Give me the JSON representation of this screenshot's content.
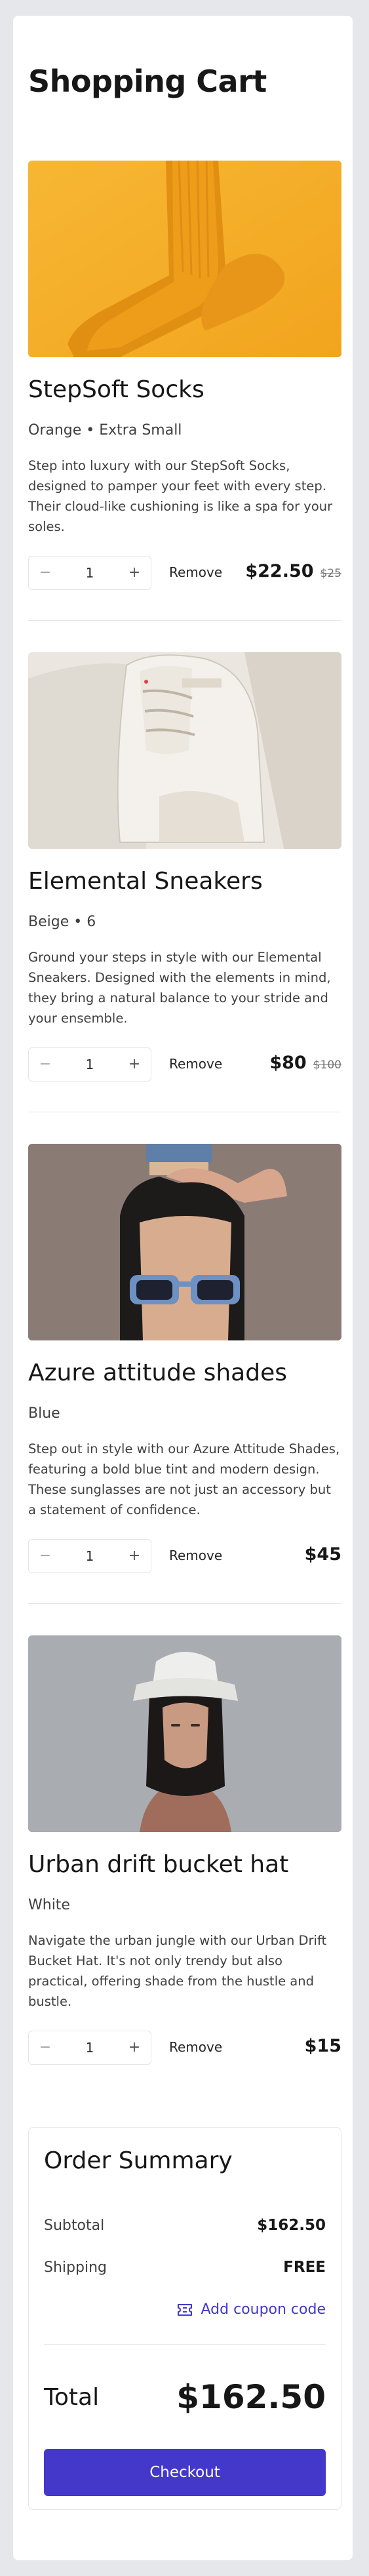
{
  "page": {
    "title": "Shopping Cart"
  },
  "items": [
    {
      "name": "StepSoft Socks",
      "variant": "Orange • Extra Small",
      "description": "Step into luxury with our StepSoft Socks, designed to pamper your feet with every step. Their cloud-like cushioning is like a spa for your soles.",
      "quantity": "1",
      "remove_label": "Remove",
      "price": "$22.50",
      "original_price": "$25",
      "image": "orange-socks"
    },
    {
      "name": "Elemental Sneakers",
      "variant": "Beige • 6",
      "description": "Ground your steps in style with our Elemental Sneakers. Designed with the elements in mind, they bring a natural balance to your stride and your ensemble.",
      "quantity": "1",
      "remove_label": "Remove",
      "price": "$80",
      "original_price": "$100",
      "image": "white-sneaker"
    },
    {
      "name": "Azure attitude shades",
      "variant": "Blue",
      "description": "Step out in style with our Azure Attitude Shades, featuring a bold blue tint and modern design. These sunglasses are not just an accessory but a statement of confidence.",
      "quantity": "1",
      "remove_label": "Remove",
      "price": "$45",
      "original_price": "",
      "image": "blue-sunglasses-model"
    },
    {
      "name": "Urban drift bucket hat",
      "variant": "White",
      "description": "Navigate the urban jungle with our Urban Drift Bucket Hat. It's not only trendy but also practical, offering shade from the hustle and bustle.",
      "quantity": "1",
      "remove_label": "Remove",
      "price": "$15",
      "original_price": "",
      "image": "bucket-hat-model"
    }
  ],
  "summary": {
    "title": "Order Summary",
    "subtotal_label": "Subtotal",
    "subtotal_value": "$162.50",
    "shipping_label": "Shipping",
    "shipping_value": "FREE",
    "coupon_label": "Add coupon code",
    "total_label": "Total",
    "total_value": "$162.50",
    "checkout_label": "Checkout"
  },
  "colors": {
    "accent": "#4338ca",
    "background": "#e5e7eb",
    "card": "#ffffff"
  },
  "icons": {
    "minus": "minus-icon",
    "plus": "plus-icon",
    "coupon": "ticket-icon"
  }
}
